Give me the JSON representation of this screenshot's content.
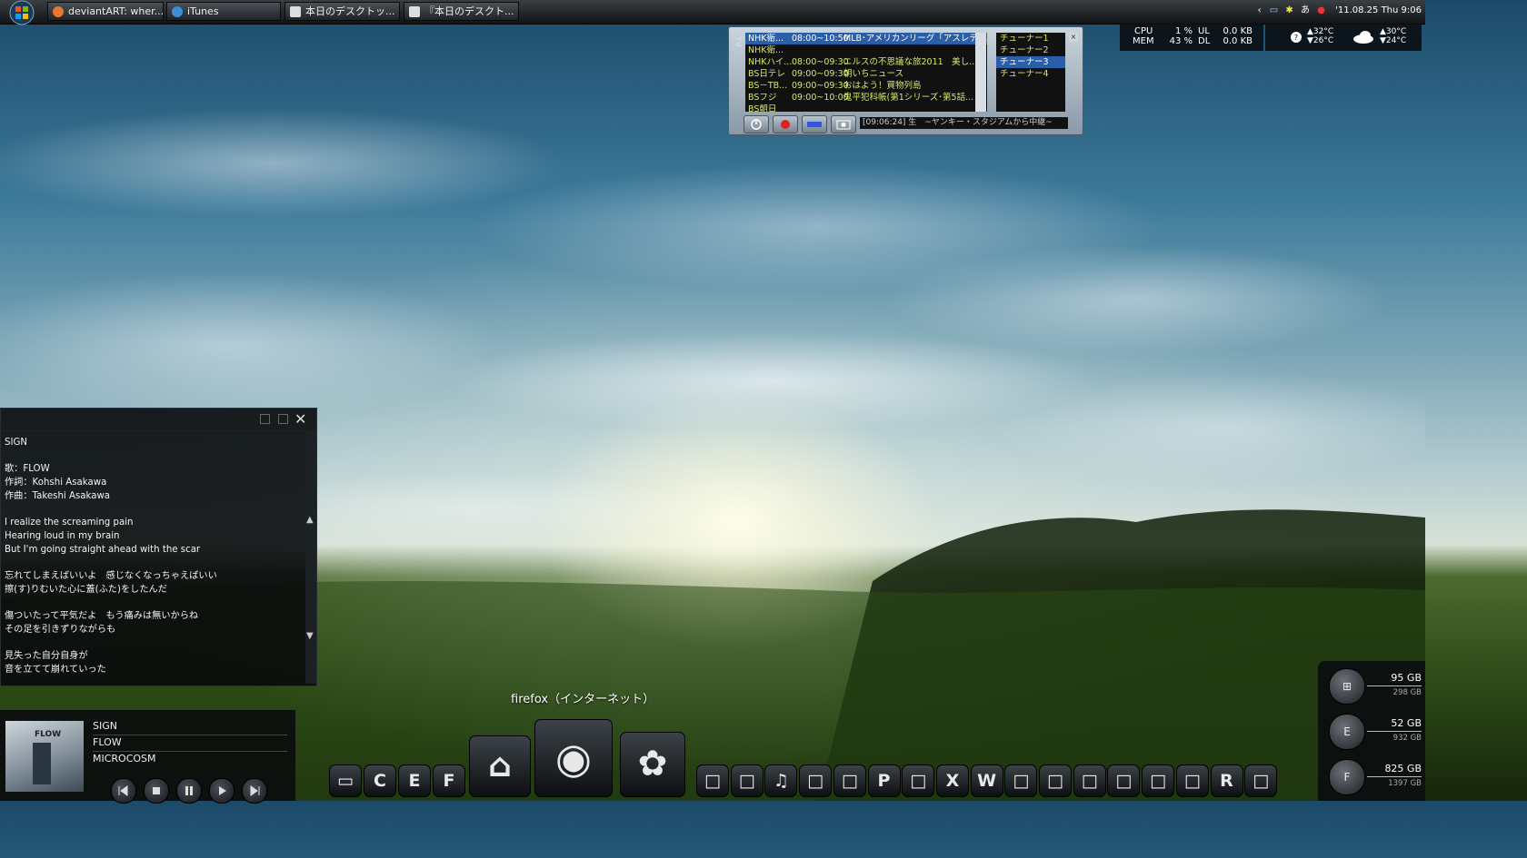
{
  "taskbar": {
    "tasks": [
      {
        "label": "deviantART: wher...",
        "icon": "firefox-icon"
      },
      {
        "label": "iTunes",
        "icon": "itunes-icon"
      },
      {
        "label": "本日のデスクトッ...",
        "icon": "window-icon"
      },
      {
        "label": "『本日のデスクト...",
        "icon": "window-icon"
      }
    ],
    "tray": {
      "datetime": "'11.08.25 Thu 9:06",
      "ime": "あ"
    }
  },
  "tv_widget": {
    "programs": [
      {
        "channel": "NHK衛...",
        "time": "08:00~10:50",
        "title": "MLB･アメリカンリーグ「アスレティ..."
      },
      {
        "channel": "NHK衛...",
        "time": "",
        "title": ""
      },
      {
        "channel": "NHKハイ...",
        "time": "08:00~09:30",
        "title": "ニルスの不思議な旅2011　美し..."
      },
      {
        "channel": "BS日テレ",
        "time": "09:00~09:30",
        "title": "朝いちニュース"
      },
      {
        "channel": "BS－TB...",
        "time": "09:00~09:30",
        "title": "おはよう！買物列島"
      },
      {
        "channel": "BSフジ",
        "time": "09:00~10:00",
        "title": "鬼平犯科帳(第1シリーズ･第5話..."
      },
      {
        "channel": "BS朝日",
        "time": "",
        "title": ""
      }
    ],
    "tuners": [
      "チューナー1",
      "チューナー2",
      "チューナー3",
      "チューナー4"
    ],
    "selected_tuner": 2,
    "status": "[09:06:24] 生　~ヤンキー・スタジアムから中継~"
  },
  "sysmon": {
    "cpu_label": "CPU",
    "cpu_value": "1 %",
    "mem_label": "MEM",
    "mem_value": "43 %",
    "ul_label": "UL",
    "ul_value": "0.0 KB",
    "dl_label": "DL",
    "dl_value": "0.0 KB"
  },
  "weather": {
    "today_hi": "▲32°C",
    "today_lo": "▼26°C",
    "tomorrow_hi": "▲30°C",
    "tomorrow_lo": "▼24°C"
  },
  "lyrics": {
    "lines": [
      "SIGN",
      "",
      "歌：FLOW",
      "作詞：Kohshi Asakawa",
      "作曲：Takeshi Asakawa",
      "",
      "I realize the screaming pain",
      "Hearing loud in my brain",
      "But I'm going straight ahead with the scar",
      "",
      "忘れてしまえばいいよ　感じなくなっちゃえばいい",
      "擦(す)りむいた心に蓋(ふた)をしたんだ",
      "",
      "傷ついたって平気だよ　もう痛みは無いからね",
      "その足を引きずりながらも",
      "",
      "見失った自分自身が",
      "音を立てて崩れていった"
    ]
  },
  "player": {
    "track": "SIGN",
    "artist": "FLOW",
    "album": "MICROCOSM",
    "cover_text": "FLOW"
  },
  "dock": {
    "label": "firefox（インターネット）",
    "small_left": [
      "",
      "C",
      "E",
      "F"
    ],
    "small_right": [
      "",
      "",
      "♫",
      "",
      "",
      "P",
      "",
      "X",
      "W",
      "",
      "",
      "",
      "",
      "",
      "",
      "R",
      ""
    ]
  },
  "drives": [
    {
      "letter": "",
      "free": "95 GB",
      "total": "298 GB"
    },
    {
      "letter": "E",
      "free": "52 GB",
      "total": "932 GB"
    },
    {
      "letter": "F",
      "free": "825 GB",
      "total": "1397 GB"
    }
  ]
}
